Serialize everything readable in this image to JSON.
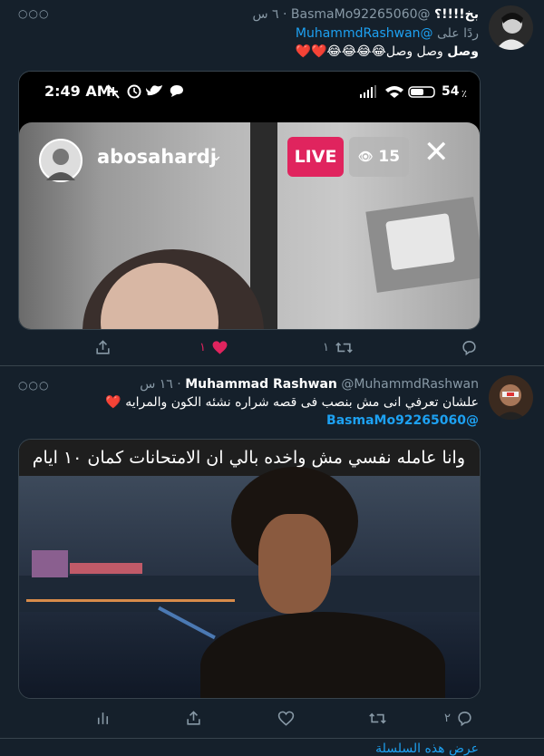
{
  "tweet1": {
    "display_name": "بخ!!!!؟",
    "handle": "@BasmaMo92265060",
    "time": "٦ س",
    "reply_prefix": "ردًا على",
    "reply_to": "@MuhammdRashwan",
    "body_bold": "وصل",
    "body_text": "وصل وصل",
    "body_emoji": "😂😂😂😂❤️❤️",
    "phone_status": {
      "time": "2:49 AM",
      "battery": "54",
      "battery_unit": "٪"
    },
    "live_screen": {
      "username": "abosahardj",
      "live_label": "LIVE",
      "viewers": "15"
    },
    "actions": {
      "retweets": "١",
      "likes": "١"
    }
  },
  "tweet2": {
    "display_name": "Muhammad Rashwan",
    "handle": "@MuhammdRashwan",
    "time": "١٦ س",
    "body_line1": "علشان تعرفي انى مش بنصب فى قصه شراره نشئه الكون والمرايه",
    "body_heart": "❤️",
    "mention": "@BasmaMo92265060",
    "image_caption": "وانا عامله نفسي مش واخده بالي ان الامتحانات كمان ١٠ ايام",
    "actions": {
      "replies": "٢"
    }
  },
  "footer": {
    "show_thread": "عرض هذه السلسلة"
  },
  "colors": {
    "background": "#15202b",
    "link": "#1da1f2",
    "muted": "#8899a6",
    "like": "#e0245e",
    "live": "#e0245e"
  }
}
